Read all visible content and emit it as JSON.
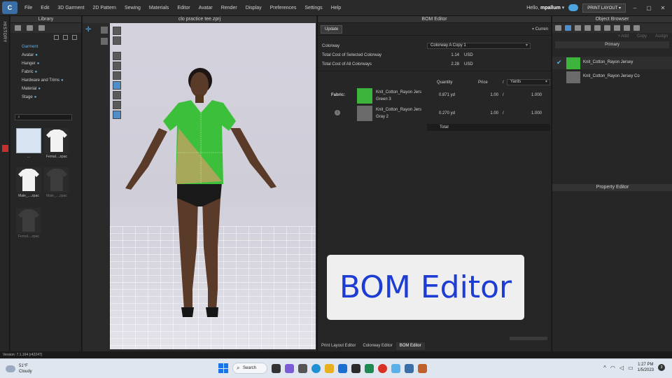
{
  "menubar": {
    "logo_text": "C",
    "items": [
      "File",
      "Edit",
      "3D Garment",
      "2D Pattern",
      "Sewing",
      "Materials",
      "Editor",
      "Avatar",
      "Render",
      "Display",
      "Preferences",
      "Settings",
      "Help"
    ],
    "hello_prefix": "Hello, ",
    "user": "mpallum",
    "print_layout": "PRINT LAYOUT ▾"
  },
  "history": {
    "label": "HISTORY"
  },
  "library": {
    "title": "Library",
    "tree": [
      {
        "label": "Garment",
        "root": true
      },
      {
        "label": "Avatar"
      },
      {
        "label": "Hanger"
      },
      {
        "label": "Fabric"
      },
      {
        "label": "Hardware and Trims"
      },
      {
        "label": "Material"
      },
      {
        "label": "Stage"
      }
    ],
    "thumbs": [
      {
        "label": "..."
      },
      {
        "label": "Femal....zpac"
      },
      {
        "label": "Male_....zpac"
      },
      {
        "label": "Male_....zpac"
      },
      {
        "label": "Femal....zpac"
      }
    ]
  },
  "viewport": {
    "title": "clo practice tee.zprj"
  },
  "bom": {
    "title": "BOM Editor",
    "update": "Update",
    "currency": "Curren",
    "colorway_label": "Colorway",
    "colorway_value": "Colorway A Copy 1",
    "sel_cost_label": "Total Cost of Selected Colorway",
    "sel_cost_value": "1.14",
    "sel_cost_unit": "USD",
    "all_cost_label": "Total Cost of All Colorways",
    "all_cost_value": "2.28",
    "all_cost_unit": "USD",
    "col_quantity": "Quantity",
    "col_price": "Price",
    "col_slash": "/",
    "col_unit": "Yards",
    "fabric_label": "Fabric:",
    "fabrics": [
      {
        "name1": "Knit_Cotton_Rayon Jers",
        "name2": "Green 3",
        "qty": "0.871 yd",
        "price": "1.00",
        "slash": "/",
        "per": "1.000",
        "color": "#3db53d"
      },
      {
        "name1": "Knit_Cotton_Rayon Jers",
        "name2": "Gray 2",
        "qty": "0.270 yd",
        "price": "1.00",
        "slash": "/",
        "per": "1.000",
        "color": "#6b6b6b"
      }
    ],
    "total_label": "Total",
    "tabs": [
      "Print Layout Editor",
      "Colorway Editor",
      "BOM Editor"
    ],
    "overlay": "BOM Editor"
  },
  "object_browser": {
    "title": "Object Browser",
    "tools": [
      "+ Add",
      "Copy",
      "Assign"
    ],
    "primary": "Primary",
    "items": [
      {
        "name": "Knit_Cotton_Rayon Jersey",
        "color": "#3db53d",
        "checked": true
      },
      {
        "name": "Knit_Cotton_Rayon Jersey Co",
        "color": "#6b6b6b",
        "checked": false
      }
    ],
    "property_title": "Property Editor"
  },
  "status": {
    "version": "Version: 7.1.164 (r42247)"
  },
  "taskbar": {
    "temp": "51°F",
    "weather": "Cloudy",
    "search": "Search",
    "time": "1:27 PM",
    "date": "1/5/2023"
  }
}
